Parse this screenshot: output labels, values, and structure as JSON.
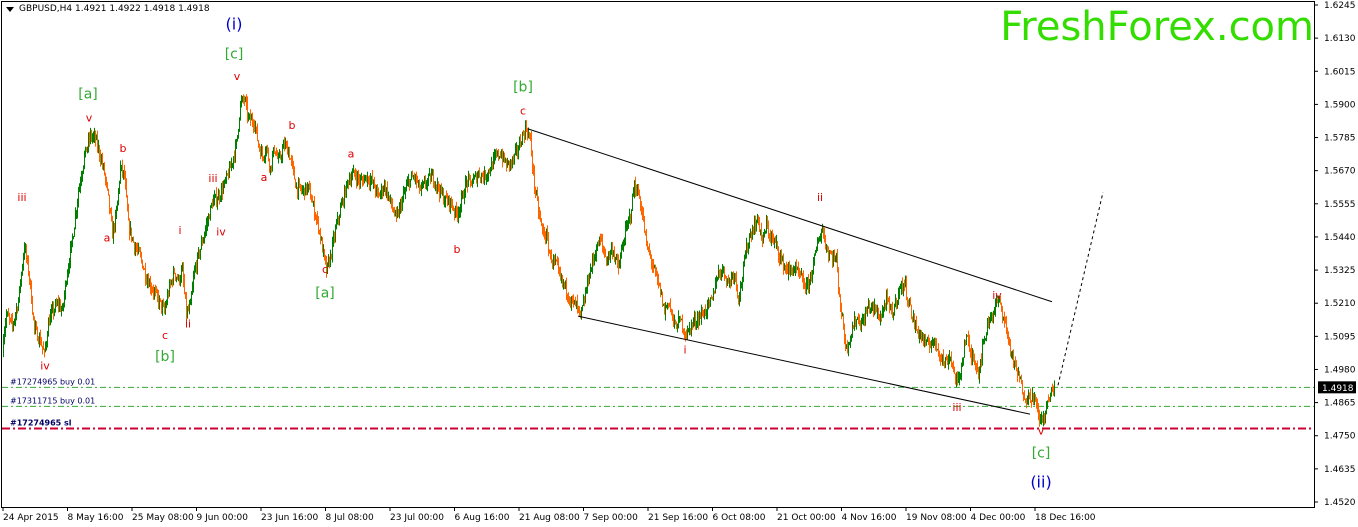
{
  "header": {
    "title": "GBPUSD,H4  1.4921 1.4922 1.4918 1.4918",
    "brand": "FreshForex.com"
  },
  "colors": {
    "background": "#ffffff",
    "candle_up": "#008000",
    "candle_down": "#ff6600",
    "wave_red": "#dd0000",
    "wave_green": "#33aa33",
    "wave_blue": "#0000cc",
    "order_line": "#33aa33",
    "stop_line": "#cc0033",
    "price_tag_bg": "#000000"
  },
  "chart_data": {
    "type": "candlestick",
    "symbol": "GBPUSD",
    "timeframe": "H4",
    "ylim": [
      1.448,
      1.625
    ],
    "y_ticks": [
      "1.6245",
      "1.6130",
      "1.6015",
      "1.5900",
      "1.5785",
      "1.5670",
      "1.5555",
      "1.5440",
      "1.5325",
      "1.5210",
      "1.5095",
      "1.4980",
      "1.4865",
      "1.4750",
      "1.4635",
      "1.4520"
    ],
    "x_ticks": [
      "24 Apr 2015",
      "8 May 16:00",
      "25 May 08:00",
      "9 Jun 00:00",
      "23 Jun 16:00",
      "8 Jul 08:00",
      "23 Jul 00:00",
      "6 Aug 16:00",
      "21 Aug 08:00",
      "7 Sep 00:00",
      "21 Sep 16:00",
      "6 Oct 08:00",
      "21 Oct 00:00",
      "4 Nov 16:00",
      "19 Nov 08:00",
      "4 Dec 00:00",
      "18 Dec 16:00"
    ],
    "current_price": "1.4918",
    "price_path": [
      [
        0,
        1.503
      ],
      [
        6,
        1.517
      ],
      [
        12,
        1.513
      ],
      [
        18,
        1.522
      ],
      [
        24,
        1.541
      ],
      [
        29,
        1.53
      ],
      [
        34,
        1.512
      ],
      [
        40,
        1.508
      ],
      [
        44,
        1.503
      ],
      [
        48,
        1.514
      ],
      [
        52,
        1.518
      ],
      [
        58,
        1.521
      ],
      [
        62,
        1.518
      ],
      [
        66,
        1.53
      ],
      [
        72,
        1.543
      ],
      [
        78,
        1.56
      ],
      [
        84,
        1.572
      ],
      [
        90,
        1.579
      ],
      [
        95,
        1.578
      ],
      [
        100,
        1.572
      ],
      [
        104,
        1.566
      ],
      [
        108,
        1.557
      ],
      [
        112,
        1.545
      ],
      [
        116,
        1.552
      ],
      [
        120,
        1.568
      ],
      [
        124,
        1.565
      ],
      [
        128,
        1.548
      ],
      [
        134,
        1.541
      ],
      [
        140,
        1.537
      ],
      [
        146,
        1.53
      ],
      [
        152,
        1.526
      ],
      [
        158,
        1.522
      ],
      [
        164,
        1.518
      ],
      [
        168,
        1.525
      ],
      [
        174,
        1.532
      ],
      [
        178,
        1.529
      ],
      [
        182,
        1.532
      ],
      [
        186,
        1.517
      ],
      [
        190,
        1.52
      ],
      [
        194,
        1.532
      ],
      [
        200,
        1.54
      ],
      [
        206,
        1.548
      ],
      [
        212,
        1.556
      ],
      [
        218,
        1.558
      ],
      [
        224,
        1.562
      ],
      [
        230,
        1.568
      ],
      [
        236,
        1.576
      ],
      [
        240,
        1.59
      ],
      [
        244,
        1.592
      ],
      [
        248,
        1.585
      ],
      [
        254,
        1.584
      ],
      [
        258,
        1.576
      ],
      [
        262,
        1.572
      ],
      [
        266,
        1.575
      ],
      [
        270,
        1.568
      ],
      [
        274,
        1.575
      ],
      [
        278,
        1.57
      ],
      [
        284,
        1.576
      ],
      [
        288,
        1.574
      ],
      [
        292,
        1.568
      ],
      [
        296,
        1.561
      ],
      [
        302,
        1.56
      ],
      [
        308,
        1.561
      ],
      [
        314,
        1.553
      ],
      [
        318,
        1.548
      ],
      [
        322,
        1.54
      ],
      [
        326,
        1.532
      ],
      [
        330,
        1.537
      ],
      [
        336,
        1.548
      ],
      [
        342,
        1.556
      ],
      [
        348,
        1.564
      ],
      [
        354,
        1.566
      ],
      [
        360,
        1.563
      ],
      [
        366,
        1.565
      ],
      [
        372,
        1.563
      ],
      [
        378,
        1.558
      ],
      [
        384,
        1.562
      ],
      [
        390,
        1.556
      ],
      [
        396,
        1.55
      ],
      [
        402,
        1.557
      ],
      [
        408,
        1.563
      ],
      [
        414,
        1.565
      ],
      [
        420,
        1.56
      ],
      [
        426,
        1.563
      ],
      [
        432,
        1.565
      ],
      [
        438,
        1.561
      ],
      [
        444,
        1.557
      ],
      [
        450,
        1.556
      ],
      [
        456,
        1.552
      ],
      [
        460,
        1.555
      ],
      [
        466,
        1.563
      ],
      [
        472,
        1.563
      ],
      [
        478,
        1.566
      ],
      [
        484,
        1.565
      ],
      [
        490,
        1.568
      ],
      [
        496,
        1.572
      ],
      [
        500,
        1.573
      ],
      [
        506,
        1.569
      ],
      [
        512,
        1.57
      ],
      [
        518,
        1.575
      ],
      [
        522,
        1.579
      ],
      [
        526,
        1.582
      ],
      [
        530,
        1.577
      ],
      [
        534,
        1.562
      ],
      [
        538,
        1.553
      ],
      [
        542,
        1.546
      ],
      [
        546,
        1.544
      ],
      [
        550,
        1.537
      ],
      [
        556,
        1.534
      ],
      [
        560,
        1.529
      ],
      [
        566,
        1.526
      ],
      [
        570,
        1.522
      ],
      [
        576,
        1.52
      ],
      [
        580,
        1.516
      ],
      [
        584,
        1.522
      ],
      [
        588,
        1.53
      ],
      [
        592,
        1.535
      ],
      [
        596,
        1.54
      ],
      [
        600,
        1.543
      ],
      [
        606,
        1.536
      ],
      [
        612,
        1.54
      ],
      [
        618,
        1.533
      ],
      [
        624,
        1.544
      ],
      [
        630,
        1.552
      ],
      [
        634,
        1.562
      ],
      [
        638,
        1.559
      ],
      [
        642,
        1.552
      ],
      [
        646,
        1.541
      ],
      [
        650,
        1.537
      ],
      [
        654,
        1.532
      ],
      [
        660,
        1.525
      ],
      [
        664,
        1.518
      ],
      [
        668,
        1.522
      ],
      [
        674,
        1.513
      ],
      [
        680,
        1.515
      ],
      [
        686,
        1.51
      ],
      [
        692,
        1.514
      ],
      [
        698,
        1.516
      ],
      [
        704,
        1.518
      ],
      [
        708,
        1.52
      ],
      [
        712,
        1.522
      ],
      [
        716,
        1.53
      ],
      [
        722,
        1.533
      ],
      [
        728,
        1.528
      ],
      [
        734,
        1.532
      ],
      [
        738,
        1.523
      ],
      [
        742,
        1.53
      ],
      [
        746,
        1.54
      ],
      [
        750,
        1.545
      ],
      [
        754,
        1.548
      ],
      [
        758,
        1.55
      ],
      [
        762,
        1.542
      ],
      [
        766,
        1.548
      ],
      [
        770,
        1.544
      ],
      [
        776,
        1.541
      ],
      [
        782,
        1.535
      ],
      [
        788,
        1.532
      ],
      [
        794,
        1.533
      ],
      [
        800,
        1.53
      ],
      [
        806,
        1.526
      ],
      [
        810,
        1.53
      ],
      [
        814,
        1.536
      ],
      [
        818,
        1.543
      ],
      [
        822,
        1.547
      ],
      [
        826,
        1.54
      ],
      [
        830,
        1.538
      ],
      [
        836,
        1.536
      ],
      [
        840,
        1.52
      ],
      [
        846,
        1.505
      ],
      [
        850,
        1.51
      ],
      [
        856,
        1.516
      ],
      [
        862,
        1.514
      ],
      [
        868,
        1.52
      ],
      [
        874,
        1.519
      ],
      [
        880,
        1.516
      ],
      [
        886,
        1.522
      ],
      [
        892,
        1.517
      ],
      [
        898,
        1.525
      ],
      [
        904,
        1.528
      ],
      [
        908,
        1.522
      ],
      [
        912,
        1.516
      ],
      [
        916,
        1.512
      ],
      [
        922,
        1.509
      ],
      [
        926,
        1.506
      ],
      [
        932,
        1.508
      ],
      [
        938,
        1.505
      ],
      [
        944,
        1.5
      ],
      [
        950,
        1.503
      ],
      [
        954,
        1.496
      ],
      [
        958,
        1.493
      ],
      [
        962,
        1.502
      ],
      [
        966,
        1.51
      ],
      [
        970,
        1.503
      ],
      [
        974,
        1.502
      ],
      [
        978,
        1.497
      ],
      [
        982,
        1.505
      ],
      [
        988,
        1.515
      ],
      [
        994,
        1.519
      ],
      [
        998,
        1.522
      ],
      [
        1002,
        1.518
      ],
      [
        1006,
        1.512
      ],
      [
        1010,
        1.505
      ],
      [
        1014,
        1.499
      ],
      [
        1018,
        1.496
      ],
      [
        1022,
        1.491
      ],
      [
        1026,
        1.488
      ],
      [
        1030,
        1.489
      ],
      [
        1034,
        1.488
      ],
      [
        1038,
        1.482
      ],
      [
        1042,
        1.48
      ],
      [
        1046,
        1.485
      ],
      [
        1050,
        1.489
      ],
      [
        1054,
        1.493
      ]
    ],
    "wave_labels": [
      {
        "text": "iii",
        "x": 22,
        "y": 1.5565,
        "color": "red"
      },
      {
        "text": "iv",
        "x": 45,
        "y": 1.498,
        "color": "red"
      },
      {
        "text": "[a]",
        "x": 88,
        "y": 1.592,
        "color": "green"
      },
      {
        "text": "v",
        "x": 89,
        "y": 1.584,
        "color": "red"
      },
      {
        "text": "b",
        "x": 123,
        "y": 1.5735,
        "color": "red"
      },
      {
        "text": "a",
        "x": 107,
        "y": 1.5425,
        "color": "red"
      },
      {
        "text": "c",
        "x": 165,
        "y": 1.5085,
        "color": "red"
      },
      {
        "text": "[b]",
        "x": 165,
        "y": 1.501,
        "color": "green"
      },
      {
        "text": "i",
        "x": 180,
        "y": 1.545,
        "color": "red"
      },
      {
        "text": "ii",
        "x": 188,
        "y": 1.5125,
        "color": "red"
      },
      {
        "text": "iii",
        "x": 213,
        "y": 1.563,
        "color": "red"
      },
      {
        "text": "iv",
        "x": 221,
        "y": 1.5445,
        "color": "red"
      },
      {
        "text": "(i)",
        "x": 234,
        "y": 1.616,
        "color": "blue"
      },
      {
        "text": "[c]",
        "x": 234,
        "y": 1.606,
        "color": "green"
      },
      {
        "text": "v",
        "x": 237,
        "y": 1.5985,
        "color": "red"
      },
      {
        "text": "b",
        "x": 292,
        "y": 1.5815,
        "color": "red"
      },
      {
        "text": "a",
        "x": 264,
        "y": 1.5635,
        "color": "red"
      },
      {
        "text": "a",
        "x": 351,
        "y": 1.5715,
        "color": "red"
      },
      {
        "text": "c",
        "x": 325,
        "y": 1.5315,
        "color": "red"
      },
      {
        "text": "[a]",
        "x": 325,
        "y": 1.523,
        "color": "green"
      },
      {
        "text": "b",
        "x": 457,
        "y": 1.5385,
        "color": "red"
      },
      {
        "text": "[b]",
        "x": 523,
        "y": 1.5945,
        "color": "green"
      },
      {
        "text": "c",
        "x": 523,
        "y": 1.5865,
        "color": "red"
      },
      {
        "text": "i",
        "x": 685,
        "y": 1.5035,
        "color": "red"
      },
      {
        "text": "ii",
        "x": 820,
        "y": 1.5565,
        "color": "red"
      },
      {
        "text": "iii",
        "x": 957,
        "y": 1.4835,
        "color": "red"
      },
      {
        "text": "iv",
        "x": 997,
        "y": 1.5225,
        "color": "red"
      },
      {
        "text": "v",
        "x": 1041,
        "y": 1.4755,
        "color": "red"
      },
      {
        "text": "[c]",
        "x": 1041,
        "y": 1.4675,
        "color": "green"
      },
      {
        "text": "(ii)",
        "x": 1041,
        "y": 1.457,
        "color": "blue"
      }
    ],
    "trendlines": [
      {
        "from": [
          528,
          1.5815
        ],
        "to": [
          1052,
          1.5215
        ],
        "style": "solid"
      },
      {
        "from": [
          578,
          1.5165
        ],
        "to": [
          1030,
          1.4825
        ],
        "style": "solid"
      },
      {
        "from": [
          1058,
          1.4925
        ],
        "to": [
          1103,
          1.5595
        ],
        "style": "dashed"
      }
    ],
    "orders": [
      {
        "label": "#17274965 buy 0.01",
        "price": 1.4918,
        "color": "green"
      },
      {
        "label": "#17311715 buy 0.01",
        "price": 1.4852,
        "color": "green"
      },
      {
        "label": "#17274965 sl",
        "price": 1.4775,
        "color": "red"
      }
    ],
    "grid": false,
    "legend": "none"
  }
}
